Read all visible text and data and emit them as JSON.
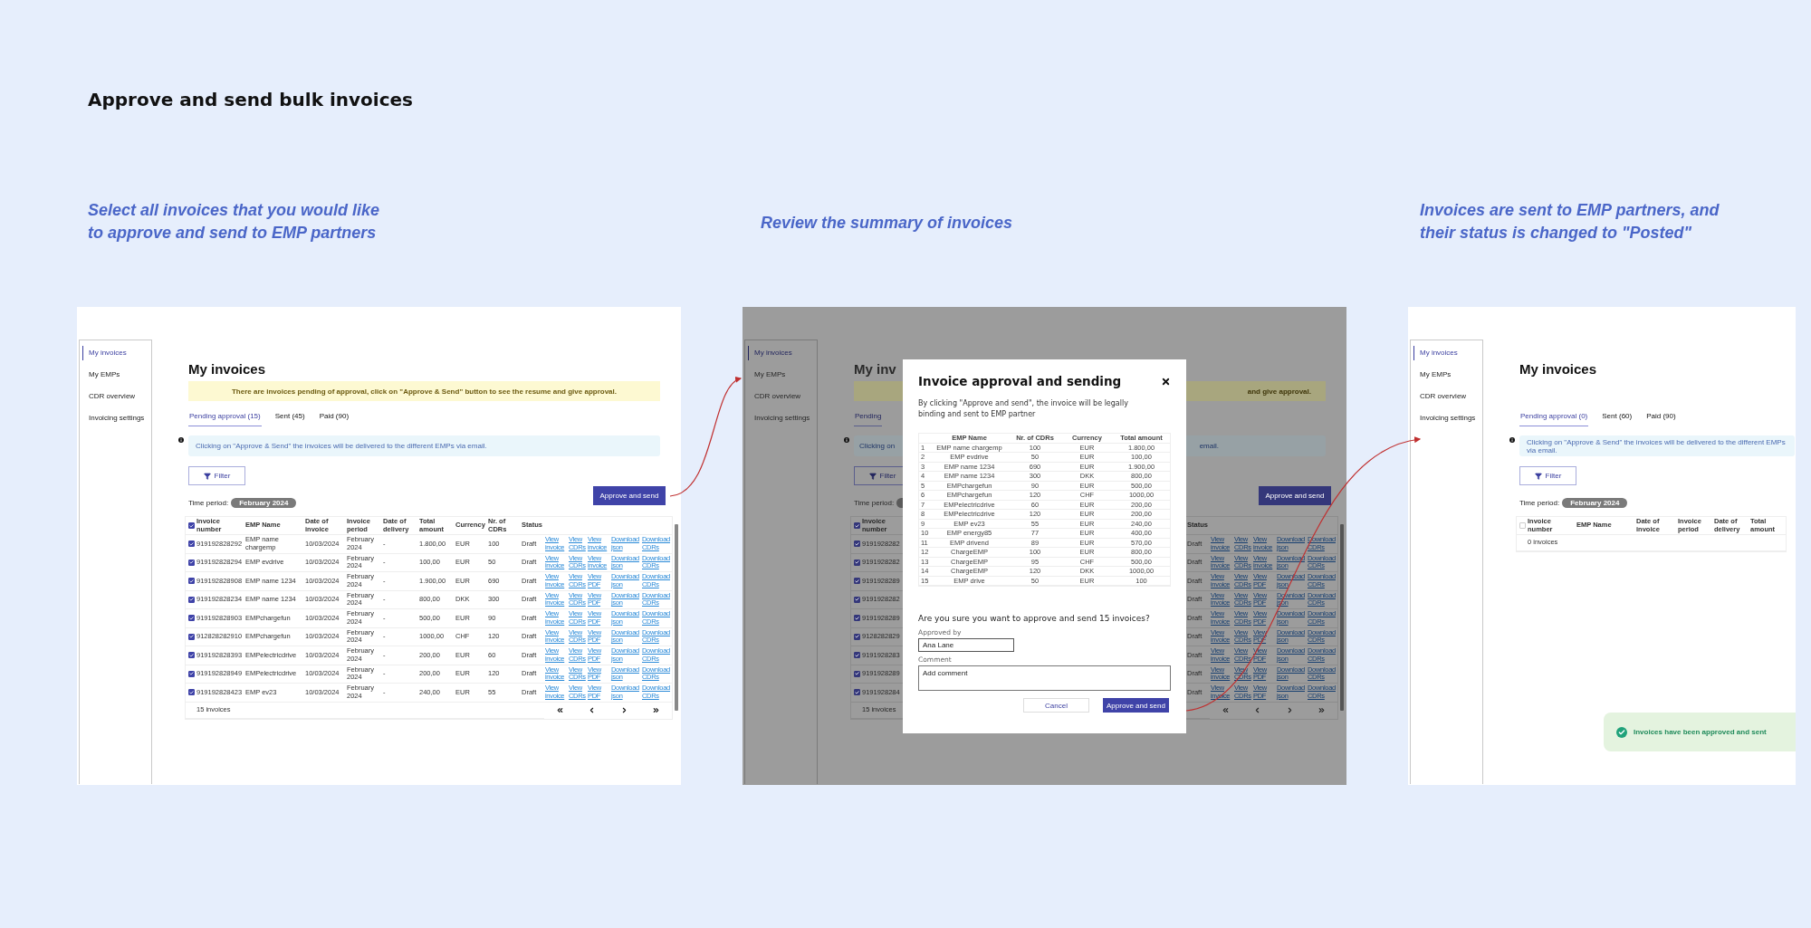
{
  "page_title": "Approve and send bulk invoices",
  "steps": [
    {
      "caption": "Select all invoices that you would like to approve and send to EMP partners",
      "screen": {
        "dimmed": false,
        "sidebar": [
          {
            "label": "My invoices",
            "selected": true
          },
          {
            "label": "My EMPs",
            "selected": false
          },
          {
            "label": "CDR overview",
            "selected": false
          },
          {
            "label": "Invoicing settings",
            "selected": false
          }
        ],
        "title": "My invoices",
        "banner": "There are invoices pending of approval, click on \"Approve & Send\" button to see the resume and give approval.",
        "tabs": [
          {
            "label": "Pending approval (15)",
            "selected": true
          },
          {
            "label": "Sent (45)",
            "selected": false
          },
          {
            "label": "Paid (90)",
            "selected": false
          }
        ],
        "info": "Clicking on \"Approve & Send\" the invoices will be delivered to the different EMPs via email.",
        "filter": "Filter",
        "time_period": {
          "label": "Time period:",
          "value": "February 2024"
        },
        "approve_button": "Approve and send",
        "table": {
          "select_all_checked": true,
          "scrollbar": true,
          "pagination": true,
          "columns": [
            "Invoice number",
            "EMP Name",
            "Date of invoice",
            "Invoice period",
            "Date of delivery",
            "Total amount",
            "Currency",
            "Nr. of CDRs",
            "Status"
          ],
          "rows": [
            {
              "checked": true,
              "cells": [
                "919192828292",
                "EMP name chargemp",
                "10/03/2024",
                "February 2024",
                "-",
                "1.800,00",
                "EUR",
                "100",
                "Draft"
              ],
              "links": [
                "View invoice",
                "View CDRs",
                "View invoice",
                "Download json",
                "Download CDRs"
              ]
            },
            {
              "checked": true,
              "cells": [
                "919192828294",
                "EMP evdrive",
                "10/03/2024",
                "February 2024",
                "-",
                "100,00",
                "EUR",
                "50",
                "Draft"
              ],
              "links": [
                "View invoice",
                "View CDRs",
                "View invoice",
                "Download json",
                "Download CDRs"
              ]
            },
            {
              "checked": true,
              "cells": [
                "919192828908",
                "EMP name 1234",
                "10/03/2024",
                "February 2024",
                "-",
                "1.900,00",
                "EUR",
                "690",
                "Draft"
              ],
              "links": [
                "View invoice",
                "View CDRs",
                "View PDF",
                "Download json",
                "Download CDRs"
              ]
            },
            {
              "checked": true,
              "cells": [
                "919192828234",
                "EMP name 1234",
                "10/03/2024",
                "February 2024",
                "-",
                "800,00",
                "DKK",
                "300",
                "Draft"
              ],
              "links": [
                "View invoice",
                "View CDRs",
                "View PDF",
                "Download json",
                "Download CDRs"
              ]
            },
            {
              "checked": true,
              "cells": [
                "919192828903",
                "EMPchargefun",
                "10/03/2024",
                "February 2024",
                "-",
                "500,00",
                "EUR",
                "90",
                "Draft"
              ],
              "links": [
                "View invoice",
                "View CDRs",
                "View PDF",
                "Download json",
                "Download CDRs"
              ]
            },
            {
              "checked": true,
              "cells": [
                "912828282910",
                "EMPchargefun",
                "10/03/2024",
                "February 2024",
                "-",
                "1000,00",
                "CHF",
                "120",
                "Draft"
              ],
              "links": [
                "View invoice",
                "View CDRs",
                "View PDF",
                "Download json",
                "Download CDRs"
              ]
            },
            {
              "checked": true,
              "cells": [
                "919192828393",
                "EMPelectricdrive",
                "10/03/2024",
                "February 2024",
                "-",
                "200,00",
                "EUR",
                "60",
                "Draft"
              ],
              "links": [
                "View invoice",
                "View CDRs",
                "View PDF",
                "Download json",
                "Download CDRs"
              ]
            },
            {
              "checked": true,
              "cells": [
                "919192828949",
                "EMPelectricdrive",
                "10/03/2024",
                "February 2024",
                "-",
                "200,00",
                "EUR",
                "120",
                "Draft"
              ],
              "links": [
                "View invoice",
                "View CDRs",
                "View PDF",
                "Download json",
                "Download CDRs"
              ]
            },
            {
              "checked": true,
              "cells": [
                "919192828423",
                "EMP ev23",
                "10/03/2024",
                "February 2024",
                "-",
                "240,00",
                "EUR",
                "55",
                "Draft"
              ],
              "links": [
                "View invoice",
                "View CDRs",
                "View PDF",
                "Download json",
                "Download CDRs"
              ]
            }
          ],
          "footer": "15 invoices"
        }
      }
    },
    {
      "caption": "Review the summary of invoices",
      "screen": {
        "dimmed": true,
        "sidebar": [
          {
            "label": "My invoices",
            "selected": true
          },
          {
            "label": "My EMPs",
            "selected": false
          },
          {
            "label": "CDR overview",
            "selected": false
          },
          {
            "label": "Invoicing settings",
            "selected": false
          }
        ],
        "title": "My inv",
        "banner": "and give approval.",
        "tabs": [
          {
            "label": "Pending",
            "selected": true
          }
        ],
        "info": "Clicking on",
        "info_end": "email.",
        "filter": "Filter",
        "time_period": {
          "label": "Time period:"
        },
        "approve_button": "Approve and send",
        "table": {
          "select_all_checked": true,
          "scrollbar": true,
          "pagination": true,
          "columns": [
            "Invoice number",
            "Status"
          ],
          "rows": [
            {
              "checked": true,
              "cells": [
                "9191928282",
                "Draft"
              ],
              "links": [
                "View invoice",
                "View CDRs",
                "View invoice",
                "Download json",
                "Download CDRs"
              ]
            },
            {
              "checked": true,
              "cells": [
                "9191928282",
                "Draft"
              ],
              "links": [
                "View invoice",
                "View CDRs",
                "View invoice",
                "Download json",
                "Download CDRs"
              ]
            },
            {
              "checked": true,
              "cells": [
                "9191928289",
                "Draft"
              ],
              "links": [
                "View invoice",
                "View CDRs",
                "View PDF",
                "Download json",
                "Download CDRs"
              ]
            },
            {
              "checked": true,
              "cells": [
                "9191928282",
                "Draft"
              ],
              "links": [
                "View invoice",
                "View CDRs",
                "View PDF",
                "Download json",
                "Download CDRs"
              ]
            },
            {
              "checked": true,
              "cells": [
                "9191928289",
                "Draft"
              ],
              "links": [
                "View invoice",
                "View CDRs",
                "View PDF",
                "Download json",
                "Download CDRs"
              ]
            },
            {
              "checked": true,
              "cells": [
                "9128282829",
                "Draft"
              ],
              "links": [
                "View invoice",
                "View CDRs",
                "View PDF",
                "Download json",
                "Download CDRs"
              ]
            },
            {
              "checked": true,
              "cells": [
                "9191928283",
                "Draft"
              ],
              "links": [
                "View invoice",
                "View CDRs",
                "View PDF",
                "Download json",
                "Download CDRs"
              ]
            },
            {
              "checked": true,
              "cells": [
                "9191928289",
                "Draft"
              ],
              "links": [
                "View invoice",
                "View CDRs",
                "View PDF",
                "Download json",
                "Download CDRs"
              ]
            },
            {
              "checked": true,
              "cells": [
                "9191928284",
                "Draft"
              ],
              "links": [
                "View invoice",
                "View CDRs",
                "View PDF",
                "Download json",
                "Download CDRs"
              ]
            }
          ],
          "footer": "15 invoices"
        },
        "modal": {
          "title": "Invoice approval and sending",
          "intro": "By clicking \"Approve and send\", the invoice will be legally binding and sent to EMP partner",
          "columns": [
            "EMP Name",
            "Nr. of CDRs",
            "Currency",
            "Total amount"
          ],
          "rows": [
            {
              "index": "1",
              "cells": [
                "EMP name chargemp",
                "100",
                "EUR",
                "1.800,00"
              ]
            },
            {
              "index": "2",
              "cells": [
                "EMP evdrive",
                "50",
                "EUR",
                "100,00"
              ]
            },
            {
              "index": "3",
              "cells": [
                "EMP name 1234",
                "690",
                "EUR",
                "1.900,00"
              ]
            },
            {
              "index": "4",
              "cells": [
                "EMP name 1234",
                "300",
                "DKK",
                "800,00"
              ]
            },
            {
              "index": "5",
              "cells": [
                "EMPchargefun",
                "90",
                "EUR",
                "500,00"
              ]
            },
            {
              "index": "6",
              "cells": [
                "EMPchargefun",
                "120",
                "CHF",
                "1000,00"
              ]
            },
            {
              "index": "7",
              "cells": [
                "EMPelectricdrive",
                "60",
                "EUR",
                "200,00"
              ]
            },
            {
              "index": "8",
              "cells": [
                "EMPelectricdrive",
                "120",
                "EUR",
                "200,00"
              ]
            },
            {
              "index": "9",
              "cells": [
                "EMP ev23",
                "55",
                "EUR",
                "240,00"
              ]
            },
            {
              "index": "10",
              "cells": [
                "EMP energy85",
                "77",
                "EUR",
                "400,00"
              ]
            },
            {
              "index": "11",
              "cells": [
                "EMP drivend",
                "89",
                "EUR",
                "570,00"
              ]
            },
            {
              "index": "12",
              "cells": [
                "ChargeEMP",
                "100",
                "EUR",
                "800,00"
              ]
            },
            {
              "index": "13",
              "cells": [
                "ChargeEMP",
                "95",
                "CHF",
                "500,00"
              ]
            },
            {
              "index": "14",
              "cells": [
                "ChargeEMP",
                "120",
                "DKK",
                "1000,00"
              ]
            },
            {
              "index": "15",
              "cells": [
                "EMP drive",
                "50",
                "EUR",
                "100"
              ]
            }
          ],
          "question": "Are you sure you want to approve and send 15 invoices?",
          "approved_by": {
            "label": "Approved by",
            "value": "Ana Lane"
          },
          "comment": {
            "label": "Comment",
            "placeholder": "Add comment"
          },
          "buttons": [
            {
              "label": "Cancel",
              "kind": "secondary"
            },
            {
              "label": "Approve and send",
              "kind": "primary"
            }
          ]
        }
      }
    },
    {
      "caption": "Invoices are sent to EMP partners, and their status is changed to \"Posted\"",
      "screen": {
        "dimmed": false,
        "sidebar": [
          {
            "label": "My invoices",
            "selected": true
          },
          {
            "label": "My EMPs",
            "selected": false
          },
          {
            "label": "CDR overview",
            "selected": false
          },
          {
            "label": "Invoicing settings",
            "selected": false
          }
        ],
        "title": "My invoices",
        "tabs": [
          {
            "label": "Pending approval (0)",
            "selected": true
          },
          {
            "label": "Sent (60)",
            "selected": false
          },
          {
            "label": "Paid (90)",
            "selected": false
          }
        ],
        "info": "Clicking on \"Approve & Send\" the invoices will be delivered to the different EMPs via email.",
        "filter": "Filter",
        "time_period": {
          "label": "Time period:",
          "value": "February 2024"
        },
        "table": {
          "select_all_checked": false,
          "scrollbar": false,
          "pagination": false,
          "columns": [
            "Invoice number",
            "EMP Name",
            "Date of invoice",
            "Invoice period",
            "Date of delivery",
            "Total amount"
          ],
          "footer": "0 invoices"
        },
        "toast": "Invoices have been approved and sent"
      }
    }
  ]
}
